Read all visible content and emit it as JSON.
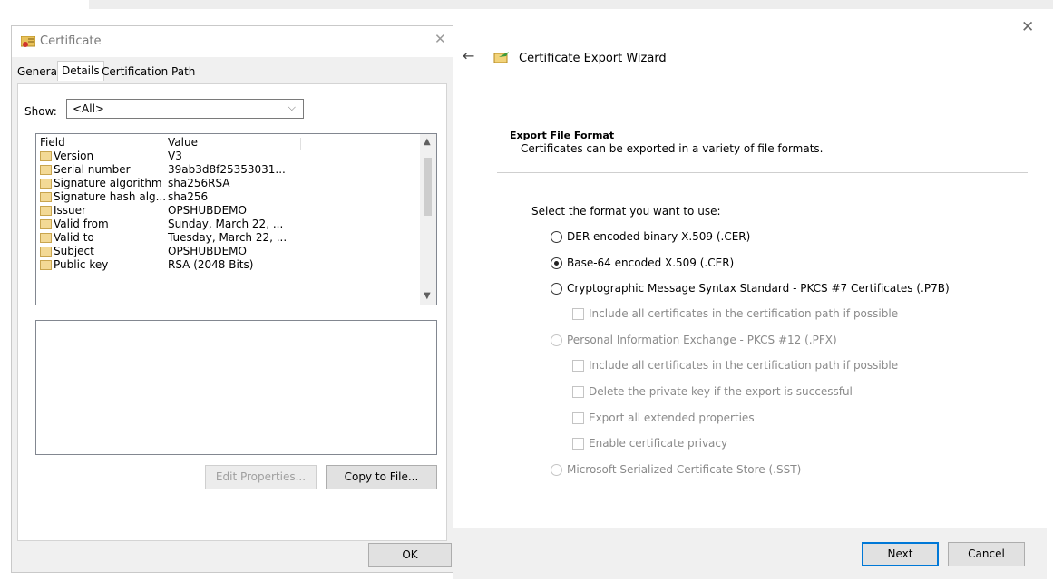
{
  "certificate_dialog": {
    "title": "Certificate",
    "tabs": [
      {
        "label": "General"
      },
      {
        "label": "Details"
      },
      {
        "label": "Certification Path"
      }
    ],
    "show_label": "Show:",
    "show_value": "<All>",
    "field_list": {
      "headers": {
        "field": "Field",
        "value": "Value"
      },
      "rows": [
        {
          "field": "Version",
          "value": "V3"
        },
        {
          "field": "Serial number",
          "value": "39ab3d8f25353031..."
        },
        {
          "field": "Signature algorithm",
          "value": "sha256RSA"
        },
        {
          "field": "Signature hash alg...",
          "value": "sha256"
        },
        {
          "field": "Issuer",
          "value": "OPSHUBDEMO"
        },
        {
          "field": "Valid from",
          "value": "Sunday, March 22, ..."
        },
        {
          "field": "Valid to",
          "value": "Tuesday, March 22, ..."
        },
        {
          "field": "Subject",
          "value": "OPSHUBDEMO"
        },
        {
          "field": "Public key",
          "value": "RSA (2048 Bits)"
        }
      ]
    },
    "buttons": {
      "edit_properties": "Edit Properties...",
      "copy_to_file": "Copy to File...",
      "ok": "OK"
    }
  },
  "export_wizard": {
    "title": "Certificate Export Wizard",
    "section_title": "Export File Format",
    "section_desc": "Certificates can be exported in a variety of file formats.",
    "prompt": "Select the format you want to use:",
    "options": {
      "der": "DER encoded binary X.509 (.CER)",
      "base64": "Base-64 encoded X.509 (.CER)",
      "pkcs7": "Cryptographic Message Syntax Standard - PKCS #7 Certificates (.P7B)",
      "pkcs7_include_all": "Include all certificates in the certification path if possible",
      "pfx": "Personal Information Exchange - PKCS #12 (.PFX)",
      "pfx_include_all": "Include all certificates in the certification path if possible",
      "pfx_delete_key": "Delete the private key if the export is successful",
      "pfx_export_ext": "Export all extended properties",
      "pfx_privacy": "Enable certificate privacy",
      "sst": "Microsoft Serialized Certificate Store (.SST)"
    },
    "selected_option": "base64",
    "buttons": {
      "next": "Next",
      "cancel": "Cancel"
    }
  }
}
